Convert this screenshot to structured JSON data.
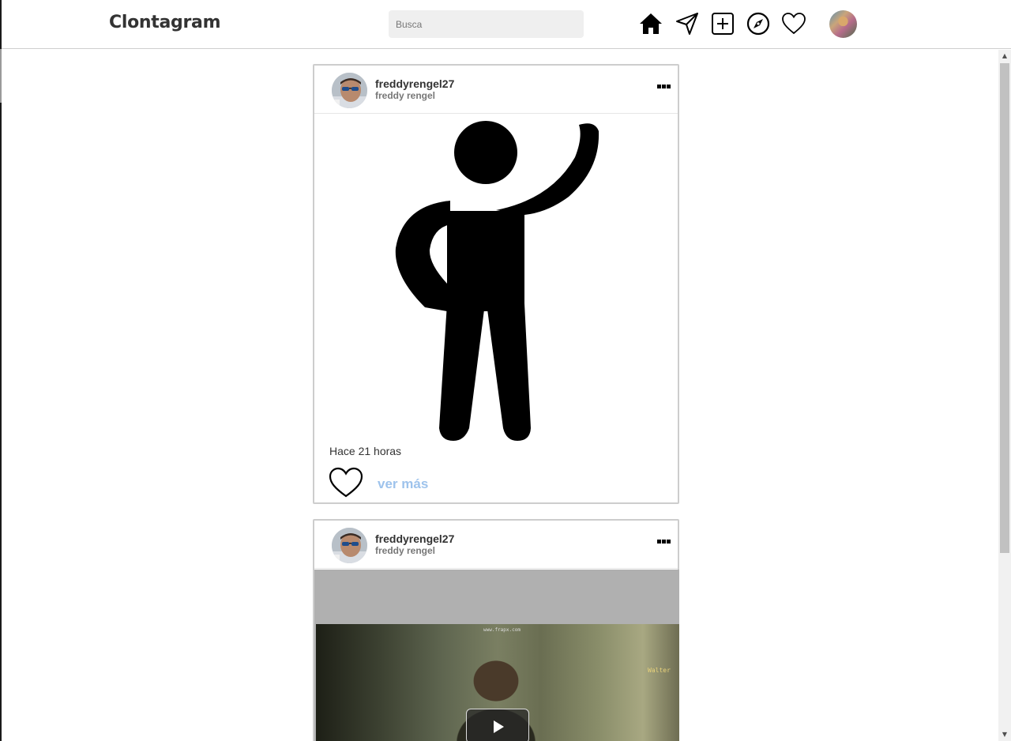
{
  "app": {
    "brand": "Clontagram"
  },
  "search": {
    "placeholder": "Busca"
  },
  "nav": {
    "icons": [
      "home-icon",
      "send-icon",
      "add-post-icon",
      "explore-icon",
      "heart-icon"
    ],
    "accent": "#000000"
  },
  "posts": [
    {
      "username": "freddyrengel27",
      "fullname": "freddy rengel",
      "time": "Hace 21 horas",
      "ver_mas": "ver más",
      "media": "person-waving-figure"
    },
    {
      "username": "freddyrengel27",
      "fullname": "freddy rengel",
      "media": "video",
      "video_watermark": "www.frapx.com",
      "video_caption": "Walter"
    }
  ],
  "colors": {
    "link": "#9ec3ec",
    "card_border": "#cdcdcd",
    "search_bg": "#efefef"
  }
}
